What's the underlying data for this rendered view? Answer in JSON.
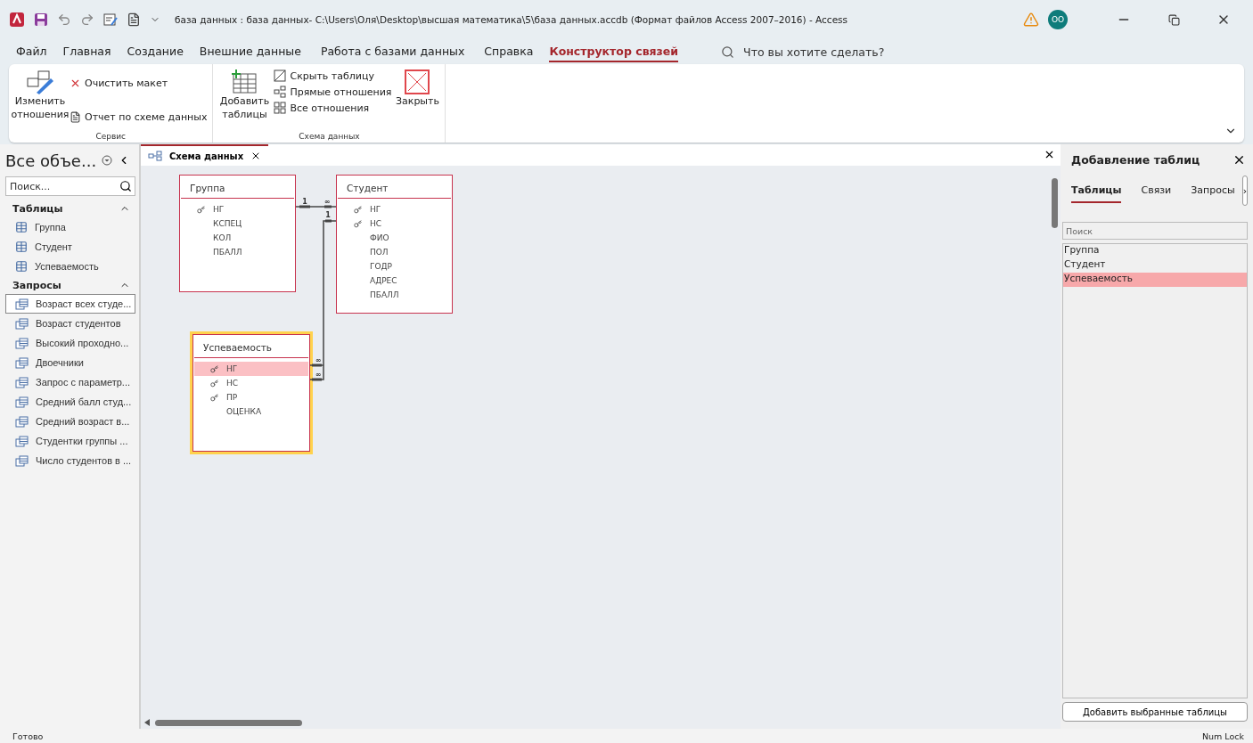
{
  "window": {
    "title": "база данных : база данных- C:\\Users\\Оля\\Desktop\\высшая математика\\5\\база данных.accdb (Формат файлов Access 2007–2016)  -  Access",
    "avatar": "ОО"
  },
  "menu_tabs": [
    {
      "label": "Файл",
      "selected": false
    },
    {
      "label": "Главная",
      "selected": false
    },
    {
      "label": "Создание",
      "selected": false
    },
    {
      "label": "Внешние данные",
      "selected": false
    },
    {
      "label": "Работа с базами данных",
      "selected": false
    },
    {
      "label": "Справка",
      "selected": false
    },
    {
      "label": "Конструктор связей",
      "selected": true
    }
  ],
  "tell_me": {
    "placeholder": "Что вы хотите сделать?"
  },
  "ribbon": {
    "groups": [
      {
        "label": "Сервис",
        "buttons": [
          {
            "kind": "large",
            "label": "Изменить отношения"
          },
          {
            "kind": "small",
            "label": "Очистить макет"
          },
          {
            "kind": "small",
            "label": "Отчет по схеме данных"
          }
        ]
      },
      {
        "label": "Схема данных",
        "buttons": [
          {
            "kind": "large",
            "label": "Добавить таблицы"
          },
          {
            "kind": "small",
            "label": "Скрыть таблицу"
          },
          {
            "kind": "small",
            "label": "Прямые отношения"
          },
          {
            "kind": "small",
            "label": "Все отношения"
          },
          {
            "kind": "large",
            "label": "Закрыть"
          }
        ]
      }
    ]
  },
  "nav_pane": {
    "title": "Все объе...",
    "search": {
      "placeholder": "Поиск..."
    },
    "groups": [
      {
        "label": "Таблицы",
        "expanded": true,
        "kind": "table",
        "items": [
          {
            "label": "Группа",
            "selected": false
          },
          {
            "label": "Студент",
            "selected": false
          },
          {
            "label": "Успеваемость",
            "selected": false
          }
        ]
      },
      {
        "label": "Запросы",
        "expanded": true,
        "kind": "query",
        "items": [
          {
            "label": "Возраст всех студе...",
            "selected": true
          },
          {
            "label": "Возраст студентов",
            "selected": false
          },
          {
            "label": "Высокий проходно...",
            "selected": false
          },
          {
            "label": "Двоечники",
            "selected": false
          },
          {
            "label": "Запрос с параметр...",
            "selected": false
          },
          {
            "label": "Средний балл студ...",
            "selected": false
          },
          {
            "label": "Средний возраст в...",
            "selected": false
          },
          {
            "label": "Студентки группы ...",
            "selected": false
          },
          {
            "label": "Число студентов в ...",
            "selected": false
          }
        ]
      }
    ]
  },
  "document_tab": {
    "label": "Схема данных"
  },
  "diagram": {
    "tables": [
      {
        "title": "Группа",
        "selected": false,
        "fields": [
          {
            "name": "НГ",
            "key": true,
            "selected": false
          },
          {
            "name": "КСПЕЦ",
            "key": false,
            "selected": false
          },
          {
            "name": "КОЛ",
            "key": false,
            "selected": false
          },
          {
            "name": "ПБАЛЛ",
            "key": false,
            "selected": false
          }
        ]
      },
      {
        "title": "Студент",
        "selected": false,
        "fields": [
          {
            "name": "НГ",
            "key": true,
            "selected": false
          },
          {
            "name": "НС",
            "key": true,
            "selected": false
          },
          {
            "name": "ФИО",
            "key": false,
            "selected": false
          },
          {
            "name": "ПОЛ",
            "key": false,
            "selected": false
          },
          {
            "name": "ГОДР",
            "key": false,
            "selected": false
          },
          {
            "name": "АДРЕС",
            "key": false,
            "selected": false
          },
          {
            "name": "ПБАЛЛ",
            "key": false,
            "selected": false
          }
        ]
      },
      {
        "title": "Успеваемость",
        "selected": true,
        "fields": [
          {
            "name": "НГ",
            "key": true,
            "selected": true
          },
          {
            "name": "НС",
            "key": true,
            "selected": false
          },
          {
            "name": "ПР",
            "key": true,
            "selected": false
          },
          {
            "name": "ОЦЕНКА",
            "key": false,
            "selected": false
          }
        ]
      }
    ],
    "relationships": [
      {
        "labels": [
          "1",
          "∞"
        ]
      },
      {
        "labels": [
          "1",
          "∞",
          "∞"
        ]
      }
    ]
  },
  "add_tables_pane": {
    "title": "Добавление таблиц",
    "tabs": [
      {
        "label": "Таблицы",
        "selected": true
      },
      {
        "label": "Связи",
        "selected": false
      },
      {
        "label": "Запросы",
        "selected": false
      }
    ],
    "more": "›",
    "search": {
      "placeholder": "Поиск"
    },
    "items": [
      {
        "label": "Группа",
        "selected": false
      },
      {
        "label": "Студент",
        "selected": false
      },
      {
        "label": "Успеваемость",
        "selected": true
      }
    ],
    "button": "Добавить выбранные таблицы"
  },
  "status_bar": {
    "left": "Готово",
    "right": "Num Lock"
  }
}
